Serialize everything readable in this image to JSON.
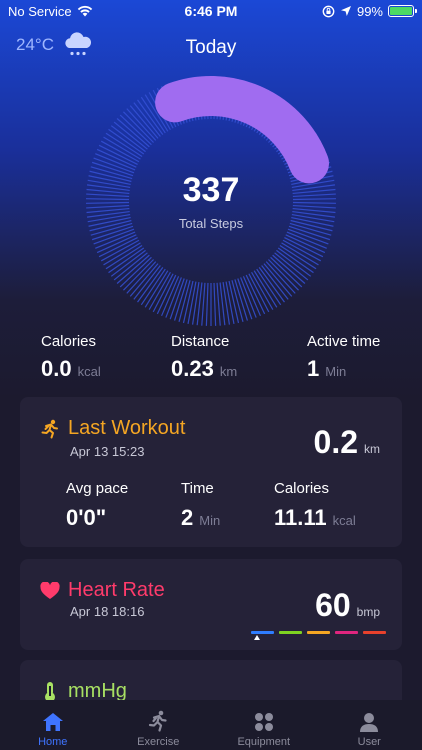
{
  "status_bar": {
    "carrier": "No Service",
    "time": "6:46 PM",
    "battery": "99%"
  },
  "weather": {
    "temperature": "24°C",
    "icon": "snow-cloud-icon"
  },
  "page_title": "Today",
  "steps": {
    "value": "337",
    "label": "Total Steps",
    "progress_fraction": 0.15
  },
  "stats": [
    {
      "label": "Calories",
      "value": "0.0",
      "unit": "kcal"
    },
    {
      "label": "Distance",
      "value": "0.23",
      "unit": "km"
    },
    {
      "label": "Active time",
      "value": "1",
      "unit": "Min"
    }
  ],
  "last_workout": {
    "title": "Last Workout",
    "date": "Apr 13 15:23",
    "distance": "0.2",
    "distance_unit": "km",
    "icon": "running-icon",
    "metrics": [
      {
        "label": "Avg pace",
        "value": "0'0\"",
        "unit": ""
      },
      {
        "label": "Time",
        "value": "2",
        "unit": "Min"
      },
      {
        "label": "Calories",
        "value": "11.11",
        "unit": "kcal"
      }
    ]
  },
  "heart_rate": {
    "title": "Heart Rate",
    "date": "Apr 18 18:16",
    "value": "60",
    "unit": "bmp",
    "icon": "heart-icon",
    "zone_colors": [
      "#2f7dff",
      "#7ed321",
      "#f5a623",
      "#e0257f",
      "#e8412c"
    ]
  },
  "blood_pressure": {
    "title": "mmHg",
    "icon": "thermometer-icon"
  },
  "tabs": [
    {
      "label": "Home",
      "icon": "home-icon",
      "active": true
    },
    {
      "label": "Exercise",
      "icon": "exercise-icon",
      "active": false
    },
    {
      "label": "Equipment",
      "icon": "equipment-icon",
      "active": false
    },
    {
      "label": "User",
      "icon": "user-icon",
      "active": false
    }
  ],
  "colors": {
    "accent": "#3f74ff",
    "ring_progress": "#a06cf0",
    "workout_title": "#f5a623",
    "heart_title": "#ff3b6b",
    "bp_title": "#a8e063"
  }
}
